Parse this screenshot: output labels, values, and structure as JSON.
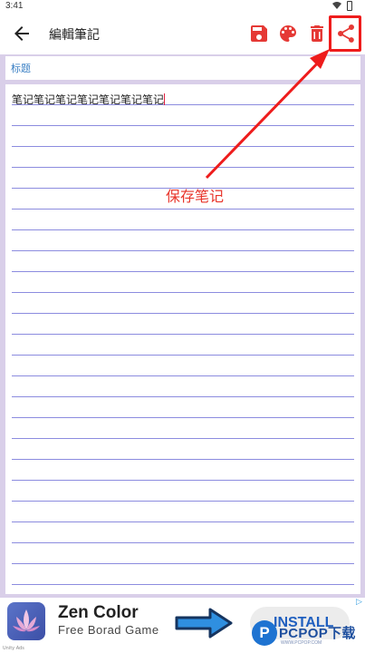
{
  "status_bar": {
    "time": "3:41"
  },
  "app_bar": {
    "title": "編輯筆記",
    "icons": {
      "back": "back-arrow-icon",
      "save": "save-icon",
      "palette": "palette-icon",
      "delete": "trash-icon",
      "share": "share-icon"
    },
    "accent_color": "#e53935"
  },
  "editor": {
    "title_placeholder": "标题",
    "body_text": "笔记笔记笔记笔记笔记笔记笔记",
    "line_color": "#8c8cdf"
  },
  "annotation": {
    "label": "保存笔记",
    "color": "#e8352b"
  },
  "ad": {
    "title": "Zen Color",
    "subtitle": "Free Borad Game",
    "install_label": "INSTALL",
    "corner_mark": "▷",
    "footer": "Unity Ads"
  },
  "watermark": {
    "logo_letter": "P",
    "text": "PCPOP下载",
    "sub": "WWW.PCPOP.COM"
  }
}
